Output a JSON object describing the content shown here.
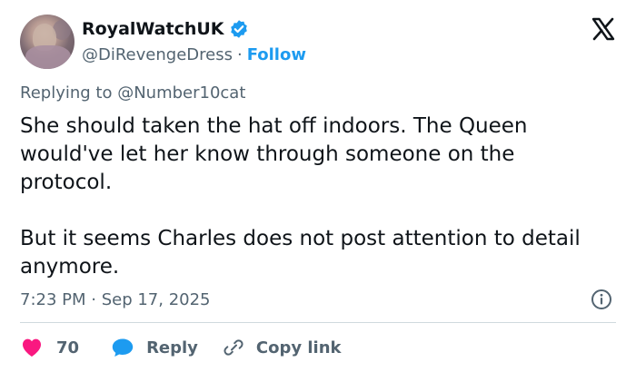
{
  "user": {
    "display_name": "RoyalWatchUK",
    "handle": "@DiRevengeDress",
    "separator": "·",
    "follow_label": "Follow"
  },
  "tweet": {
    "reply_context": "Replying to @Number10cat",
    "paragraphs": [
      "She should taken the hat off indoors. The Queen would've let her know through someone on the protocol.",
      "But it seems Charles does not post attention to detail anymore."
    ],
    "timestamp": "7:23 PM · Sep 17, 2025"
  },
  "actions": {
    "like_count": "70",
    "reply_label": "Reply",
    "copy_link_label": "Copy link"
  },
  "colors": {
    "text": "#0f1419",
    "secondary": "#536471",
    "accent": "#1d9bf0",
    "like": "#f91880",
    "divider": "#cfd9de"
  },
  "icons": [
    "verified-badge-icon",
    "x-logo-icon",
    "info-icon",
    "heart-icon",
    "reply-bubble-icon",
    "link-icon"
  ]
}
